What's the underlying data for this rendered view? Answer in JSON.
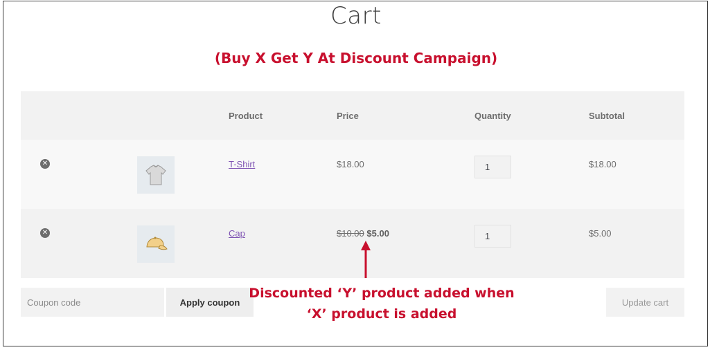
{
  "page": {
    "title": "Cart",
    "campaign": "(Buy X Get Y At Discount Campaign)"
  },
  "table": {
    "headers": {
      "product": "Product",
      "price": "Price",
      "quantity": "Quantity",
      "subtotal": "Subtotal"
    },
    "rows": [
      {
        "product": "T-Shirt",
        "price": "$18.00",
        "quantity": "1",
        "subtotal": "$18.00",
        "thumb_icon": "tshirt-icon"
      },
      {
        "product": "Cap",
        "original_price": "$10.00",
        "sale_price": "$5.00",
        "quantity": "1",
        "subtotal": "$5.00",
        "thumb_icon": "cap-icon"
      }
    ]
  },
  "actions": {
    "coupon_placeholder": "Coupon code",
    "apply_coupon": "Apply coupon",
    "update_cart": "Update cart"
  },
  "annotation": {
    "line1": "Discounted ‘Y’ product added when",
    "line2": "‘X’ product is added",
    "color": "#c8102e"
  }
}
